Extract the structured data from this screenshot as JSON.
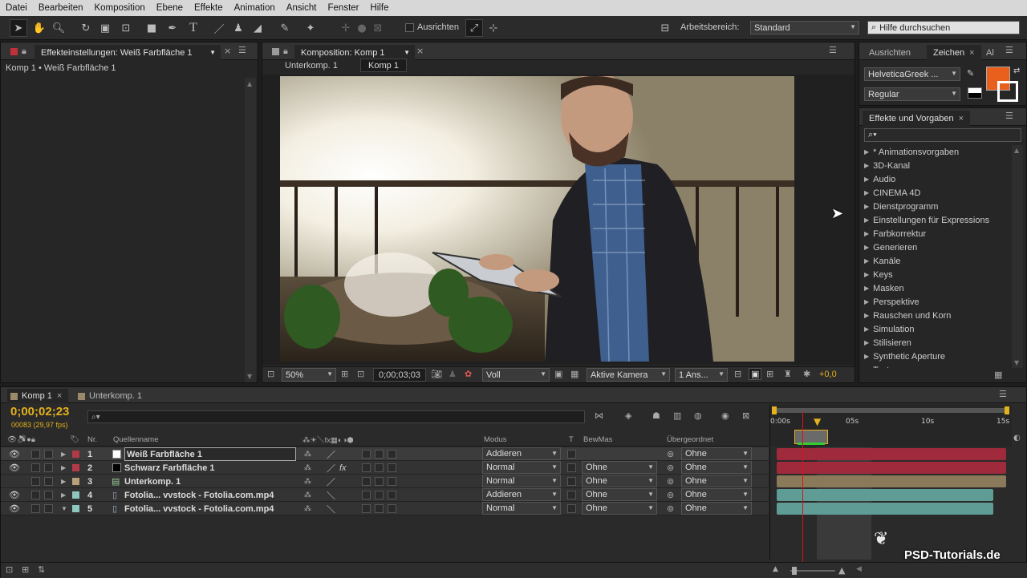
{
  "menu": [
    "Datei",
    "Bearbeiten",
    "Komposition",
    "Ebene",
    "Effekte",
    "Animation",
    "Ansicht",
    "Fenster",
    "Hilfe"
  ],
  "toolbar": {
    "align_label": "Ausrichten",
    "workspace_label": "Arbeitsbereich:",
    "workspace_value": "Standard",
    "help_placeholder": "Hilfe durchsuchen"
  },
  "effect_panel": {
    "tab": "Effekteinstellungen: Weiß Farbfläche 1",
    "breadcrumb": "Komp 1 • Weiß Farbfläche 1"
  },
  "comp_panel": {
    "tab": "Komposition: Komp 1",
    "crumbs": [
      "Unterkomp. 1",
      "Komp 1"
    ],
    "zoom": "50%",
    "timecode": "0;00;03;03",
    "resolution": "Voll",
    "camera": "Aktive Kamera",
    "views": "1 Ans...",
    "exposure": "+0,0"
  },
  "char_panel": {
    "tabs": [
      "Ausrichten",
      "Zeichen",
      "Al"
    ],
    "font": "HelveticaGreek ...",
    "style": "Regular",
    "fill_color": "#e8601c"
  },
  "effects_panel": {
    "title": "Effekte und Vorgaben",
    "items": [
      "* Animationsvorgaben",
      "3D-Kanal",
      "Audio",
      "CINEMA 4D",
      "Dienstprogramm",
      "Einstellungen für Expressions",
      "Farbkorrektur",
      "Generieren",
      "Kanäle",
      "Keys",
      "Masken",
      "Perspektive",
      "Rauschen und Korn",
      "Simulation",
      "Stilisieren",
      "Synthetic Aperture",
      "Text"
    ]
  },
  "timeline": {
    "tabs": [
      "Komp 1",
      "Unterkomp. 1"
    ],
    "timecode": "0;00;02;23",
    "fps": "00083 (29,97 fps)",
    "columns": {
      "nr": "Nr.",
      "source": "Quellenname",
      "mode": "Modus",
      "t": "T",
      "trkmat": "BewMas",
      "parent": "Übergeordnet"
    },
    "ruler": [
      "0:00s",
      "05s",
      "10s",
      "15s"
    ],
    "layers": [
      {
        "nr": "1",
        "name": "Weiß Farbfläche 1",
        "mode": "Addieren",
        "trkmat": "",
        "parent": "Ohne",
        "label": "#b23a48",
        "swatch": "#ffffff",
        "bar": "#9e2a3c",
        "eye": true,
        "fx": false
      },
      {
        "nr": "2",
        "name": "Schwarz Farbfläche 1",
        "mode": "Normal",
        "trkmat": "Ohne",
        "parent": "Ohne",
        "label": "#b23a48",
        "swatch": "#000000",
        "bar": "#9e2a3c",
        "eye": true,
        "fx": true
      },
      {
        "nr": "3",
        "name": "Unterkomp. 1",
        "mode": "Normal",
        "trkmat": "Ohne",
        "parent": "Ohne",
        "label": "#b8a07a",
        "swatch": "comp",
        "bar": "#8a7a5a",
        "eye": false,
        "fx": false
      },
      {
        "nr": "4",
        "name": "Fotolia... vvstock - Fotolia.com.mp4",
        "mode": "Addieren",
        "trkmat": "Ohne",
        "parent": "Ohne",
        "label": "#8ec7c0",
        "swatch": "file",
        "bar": "#5e9c95",
        "eye": true,
        "fx": false
      },
      {
        "nr": "5",
        "name": "Fotolia... vvstock - Fotolia.com.mp4",
        "mode": "Normal",
        "trkmat": "Ohne",
        "parent": "Ohne",
        "label": "#8ec7c0",
        "swatch": "file",
        "bar": "#5e9c95",
        "eye": true,
        "fx": false
      }
    ]
  },
  "watermark": "PSD-Tutorials.de",
  "colors": {
    "accent": "#e8a33a",
    "timecode": "#e3b11b",
    "playhead": "#d11"
  }
}
